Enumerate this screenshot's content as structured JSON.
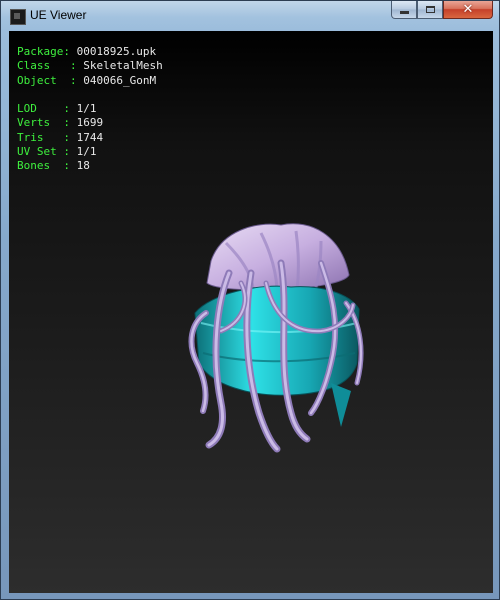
{
  "window": {
    "title": "UE Viewer",
    "icon": "ue-viewer-app-icon",
    "controls": {
      "minimize_icon": "minimize-icon",
      "maximize_icon": "maximize-icon",
      "close_icon": "close-icon"
    }
  },
  "info_group1": [
    {
      "label": "Package: ",
      "value": "00018925.upk"
    },
    {
      "label": "Class   : ",
      "value": "SkeletalMesh"
    },
    {
      "label": "Object  : ",
      "value": "040066_GonM"
    }
  ],
  "info_group2": [
    {
      "label": "LOD    : ",
      "value": "1/1"
    },
    {
      "label": "Verts  : ",
      "value": "1699"
    },
    {
      "label": "Tris   : ",
      "value": "1744"
    },
    {
      "label": "UV Set : ",
      "value": "1/1"
    },
    {
      "label": "Bones  : ",
      "value": "18"
    }
  ],
  "colors": {
    "label": "#3ef03e",
    "value": "#e8e8e8",
    "model_band": "#1fc6cf",
    "model_top": "#cdb6e6"
  }
}
